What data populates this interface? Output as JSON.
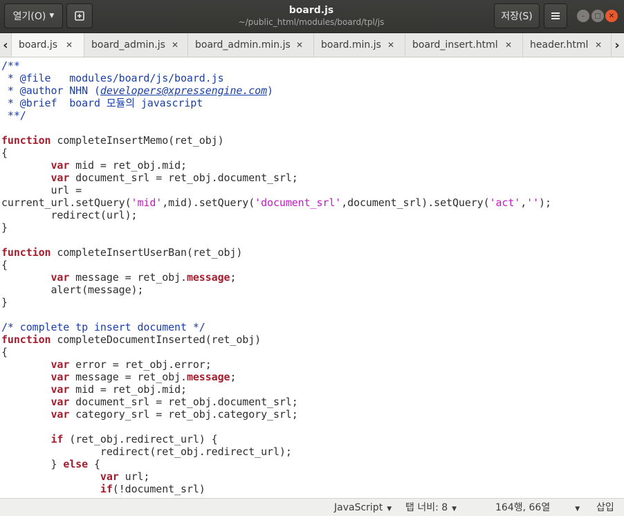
{
  "header": {
    "open_label": "열기(O)",
    "title": "board.js",
    "subtitle": "~/public_html/modules/board/tpl/js",
    "save_label": "저장(S)"
  },
  "tabs": [
    {
      "label": "board.js",
      "active": true
    },
    {
      "label": "board_admin.js",
      "active": false
    },
    {
      "label": "board_admin.min.js",
      "active": false
    },
    {
      "label": "board.min.js",
      "active": false
    },
    {
      "label": "board_insert.html",
      "active": false
    },
    {
      "label": "header.html",
      "active": false
    }
  ],
  "editor": {
    "lines": [
      [
        [
          "cm",
          "/**"
        ]
      ],
      [
        [
          "cm",
          " * @file   modules/board/js/board.js"
        ]
      ],
      [
        [
          "cm",
          " * @author NHN ("
        ],
        [
          "cmlink",
          "developers@xpressengine.com"
        ],
        [
          "cm",
          ")"
        ]
      ],
      [
        [
          "cm",
          " * @brief  board 모듈의 javascript"
        ]
      ],
      [
        [
          "cm",
          " **/"
        ]
      ],
      [],
      [
        [
          "kw",
          "function"
        ],
        [
          "t",
          " completeInsertMemo(ret_obj)"
        ]
      ],
      [
        [
          "t",
          "{"
        ]
      ],
      [
        [
          "t",
          "        "
        ],
        [
          "kw",
          "var"
        ],
        [
          "t",
          " mid = ret_obj.mid;"
        ]
      ],
      [
        [
          "t",
          "        "
        ],
        [
          "kw",
          "var"
        ],
        [
          "t",
          " document_srl = ret_obj.document_srl;"
        ]
      ],
      [
        [
          "t",
          "        url ="
        ]
      ],
      [
        [
          "t",
          "current_url.setQuery("
        ],
        [
          "str",
          "'mid'"
        ],
        [
          "t",
          ",mid).setQuery("
        ],
        [
          "str",
          "'document_srl'"
        ],
        [
          "t",
          ",document_srl).setQuery("
        ],
        [
          "str",
          "'act'"
        ],
        [
          "t",
          ","
        ],
        [
          "str",
          "''"
        ],
        [
          "t",
          ");"
        ]
      ],
      [
        [
          "t",
          "        redirect(url);"
        ]
      ],
      [
        [
          "t",
          "}"
        ]
      ],
      [],
      [
        [
          "kw",
          "function"
        ],
        [
          "t",
          " completeInsertUserBan(ret_obj)"
        ]
      ],
      [
        [
          "t",
          "{"
        ]
      ],
      [
        [
          "t",
          "        "
        ],
        [
          "kw",
          "var"
        ],
        [
          "t",
          " message = ret_obj."
        ],
        [
          "kw",
          "message"
        ],
        [
          "t",
          ";"
        ]
      ],
      [
        [
          "t",
          "        alert(message);"
        ]
      ],
      [
        [
          "t",
          "}"
        ]
      ],
      [],
      [
        [
          "cm",
          "/* complete tp insert document */"
        ]
      ],
      [
        [
          "kw",
          "function"
        ],
        [
          "t",
          " completeDocumentInserted(ret_obj)"
        ]
      ],
      [
        [
          "t",
          "{"
        ]
      ],
      [
        [
          "t",
          "        "
        ],
        [
          "kw",
          "var"
        ],
        [
          "t",
          " error = ret_obj.error;"
        ]
      ],
      [
        [
          "t",
          "        "
        ],
        [
          "kw",
          "var"
        ],
        [
          "t",
          " message = ret_obj."
        ],
        [
          "kw",
          "message"
        ],
        [
          "t",
          ";"
        ]
      ],
      [
        [
          "t",
          "        "
        ],
        [
          "kw",
          "var"
        ],
        [
          "t",
          " mid = ret_obj.mid;"
        ]
      ],
      [
        [
          "t",
          "        "
        ],
        [
          "kw",
          "var"
        ],
        [
          "t",
          " document_srl = ret_obj.document_srl;"
        ]
      ],
      [
        [
          "t",
          "        "
        ],
        [
          "kw",
          "var"
        ],
        [
          "t",
          " category_srl = ret_obj.category_srl;"
        ]
      ],
      [],
      [
        [
          "t",
          "        "
        ],
        [
          "kw",
          "if"
        ],
        [
          "t",
          " (ret_obj.redirect_url) {"
        ]
      ],
      [
        [
          "t",
          "                redirect(ret_obj.redirect_url);"
        ]
      ],
      [
        [
          "t",
          "        } "
        ],
        [
          "kw",
          "else"
        ],
        [
          "t",
          " {"
        ]
      ],
      [
        [
          "t",
          "                "
        ],
        [
          "kw",
          "var"
        ],
        [
          "t",
          " url;"
        ]
      ],
      [
        [
          "t",
          "                "
        ],
        [
          "kw",
          "if"
        ],
        [
          "t",
          "(!document_srl)"
        ]
      ]
    ]
  },
  "status": {
    "language": "JavaScript",
    "tab_width": "탭 너비: 8",
    "position": "164행, 66열",
    "mode": "삽입"
  }
}
